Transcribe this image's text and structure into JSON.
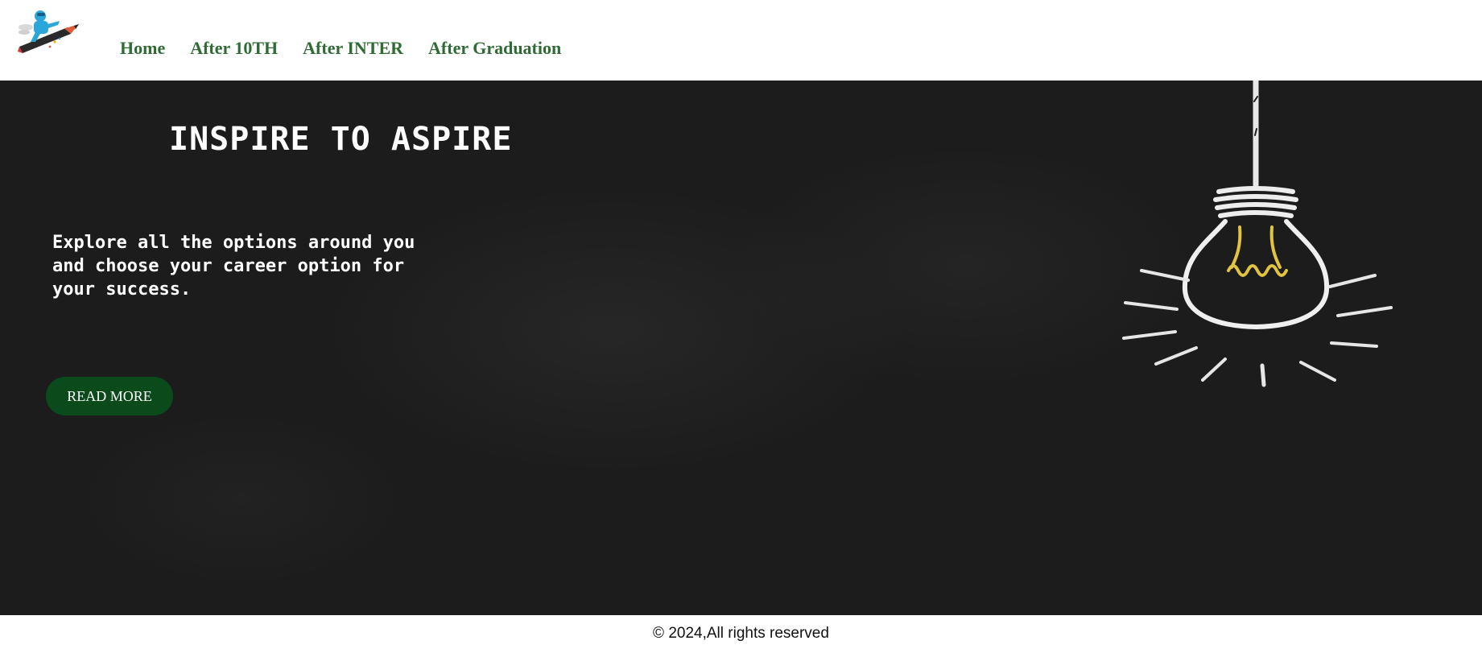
{
  "header": {
    "logo_icon": "rocket-pencil-logo-icon",
    "nav": [
      {
        "label": "Home"
      },
      {
        "label": "After 10TH"
      },
      {
        "label": "After INTER"
      },
      {
        "label": "After Graduation"
      }
    ]
  },
  "hero": {
    "title": "INSPIRE TO ASPIRE",
    "text": "Explore all the options around you and choose your career option for your success.",
    "button_label": "READ MORE",
    "illustration_icon": "lightbulb-icon"
  },
  "footer": {
    "copyright": "© 2024,All rights reserved"
  },
  "colors": {
    "nav_text": "#2f6b34",
    "hero_bg": "#1c1c1c",
    "button_bg": "#0b4a1a",
    "bulb_filament": "#e3c441"
  }
}
